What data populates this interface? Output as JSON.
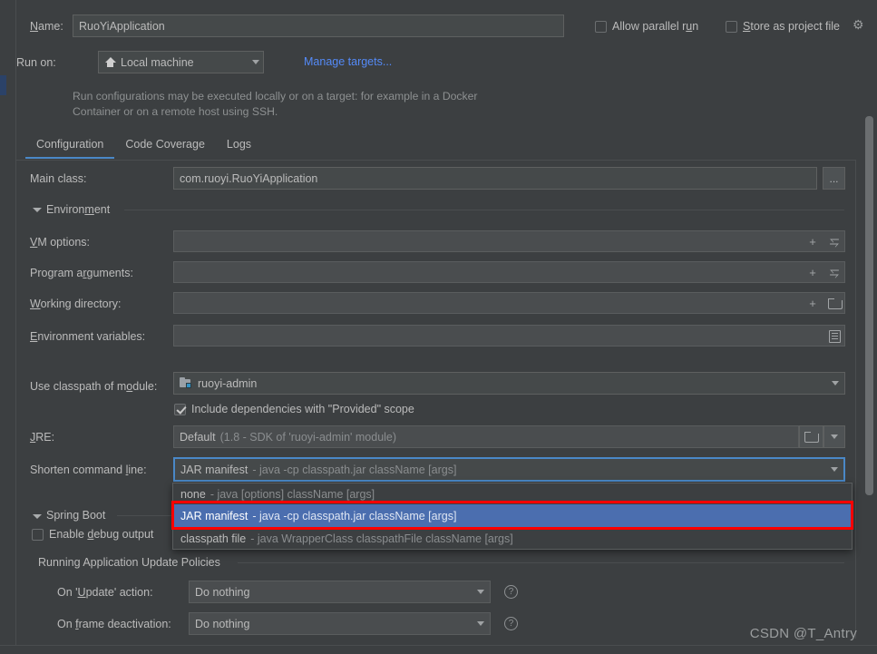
{
  "header": {
    "name_label": "Name:",
    "name_value": "RuoYiApplication",
    "allow_parallel_run": "Allow parallel run",
    "store_as_project_file": "Store as project file",
    "gear_icon": "gear-icon",
    "run_on_label": "Run on:",
    "run_on_value": "Local machine",
    "manage_targets": "Manage targets...",
    "hint": "Run configurations may be executed locally or on a target: for example in a Docker Container or on a remote host using SSH."
  },
  "tabs": [
    {
      "label": "Configuration",
      "active": true
    },
    {
      "label": "Code Coverage",
      "active": false
    },
    {
      "label": "Logs",
      "active": false
    }
  ],
  "configuration": {
    "main_class_label": "Main class:",
    "main_class_value": "com.ruoyi.RuoYiApplication",
    "browse_button": "...",
    "environment_section": "Environment",
    "vm_options_label": "VM options:",
    "vm_options_value": "",
    "program_arguments_label": "Program arguments:",
    "program_arguments_value": "",
    "working_directory_label": "Working directory:",
    "working_directory_value": "",
    "environment_variables_label": "Environment variables:",
    "environment_variables_value": "",
    "module_label": "Use classpath of module:",
    "module_value": "ruoyi-admin",
    "include_provided_label": "Include dependencies with \"Provided\" scope",
    "include_provided_checked": true,
    "jre_label": "JRE:",
    "jre_value": "Default",
    "jre_value_hint": "(1.8 - SDK of 'ruoyi-admin' module)",
    "shorten_label": "Shorten command line:",
    "shorten_value": "JAR manifest",
    "shorten_value_hint": "- java -cp classpath.jar className [args]"
  },
  "shorten_dropdown": {
    "open": true,
    "items": [
      {
        "name": "none",
        "hint": "- java [options] className [args]",
        "selected": false
      },
      {
        "name": "JAR manifest",
        "hint": "- java -cp classpath.jar className [args]",
        "selected": true
      },
      {
        "name": "classpath file",
        "hint": "- java WrapperClass classpathFile className [args]",
        "selected": false
      }
    ],
    "highlight_color": "#fe0000",
    "selection_color": "#4b6eaf"
  },
  "spring_boot": {
    "section_title": "Spring Boot",
    "enable_debug_output": "Enable debug output",
    "enable_debug_checked": false
  },
  "update_policies": {
    "section_title": "Running Application Update Policies",
    "on_update_label": "On 'Update' action:",
    "on_update_value": "Do nothing",
    "on_frame_label": "On frame deactivation:",
    "on_frame_value": "Do nothing",
    "help_icon": "question-mark-icon"
  },
  "watermark": "CSDN @T_Antry"
}
